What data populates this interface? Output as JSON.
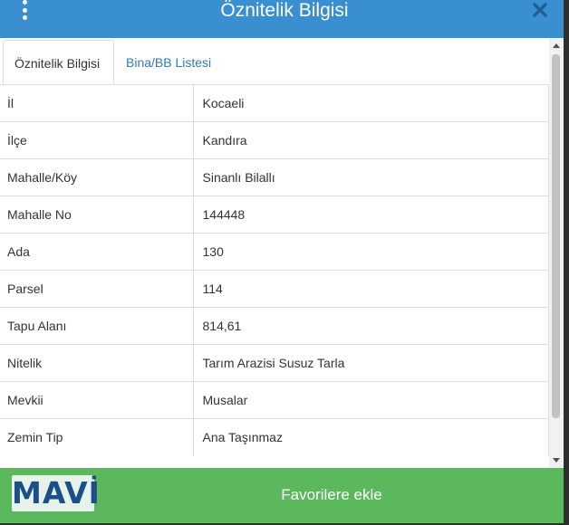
{
  "header": {
    "title": "Öznitelik Bilgisi",
    "menu_icon": "vertical-dots-icon",
    "close_icon": "close-icon"
  },
  "tabs": [
    {
      "label": "Öznitelik Bilgisi",
      "active": true
    },
    {
      "label": "Bina/BB Listesi",
      "active": false
    }
  ],
  "rows": [
    {
      "key": "İl",
      "value": "Kocaeli"
    },
    {
      "key": "İlçe",
      "value": "Kandıra"
    },
    {
      "key": "Mahalle/Köy",
      "value": "Sinanlı Bilallı"
    },
    {
      "key": "Mahalle No",
      "value": "144448"
    },
    {
      "key": "Ada",
      "value": "130"
    },
    {
      "key": "Parsel",
      "value": "114"
    },
    {
      "key": "Tapu Alanı",
      "value": "814,61"
    },
    {
      "key": "Nitelik",
      "value": "Tarım Arazisi Susuz Tarla"
    },
    {
      "key": "Mevkii",
      "value": "Musalar"
    },
    {
      "key": "Zemin Tip",
      "value": "Ana Taşınmaz"
    }
  ],
  "footer": {
    "logo_text": "MAVİ",
    "button_label": "Favorilere ekle"
  },
  "colors": {
    "header": "#3a8fd0",
    "footer": "#5cb85c",
    "tab_link": "#337ab7",
    "logo_text": "#1c4f8a"
  }
}
